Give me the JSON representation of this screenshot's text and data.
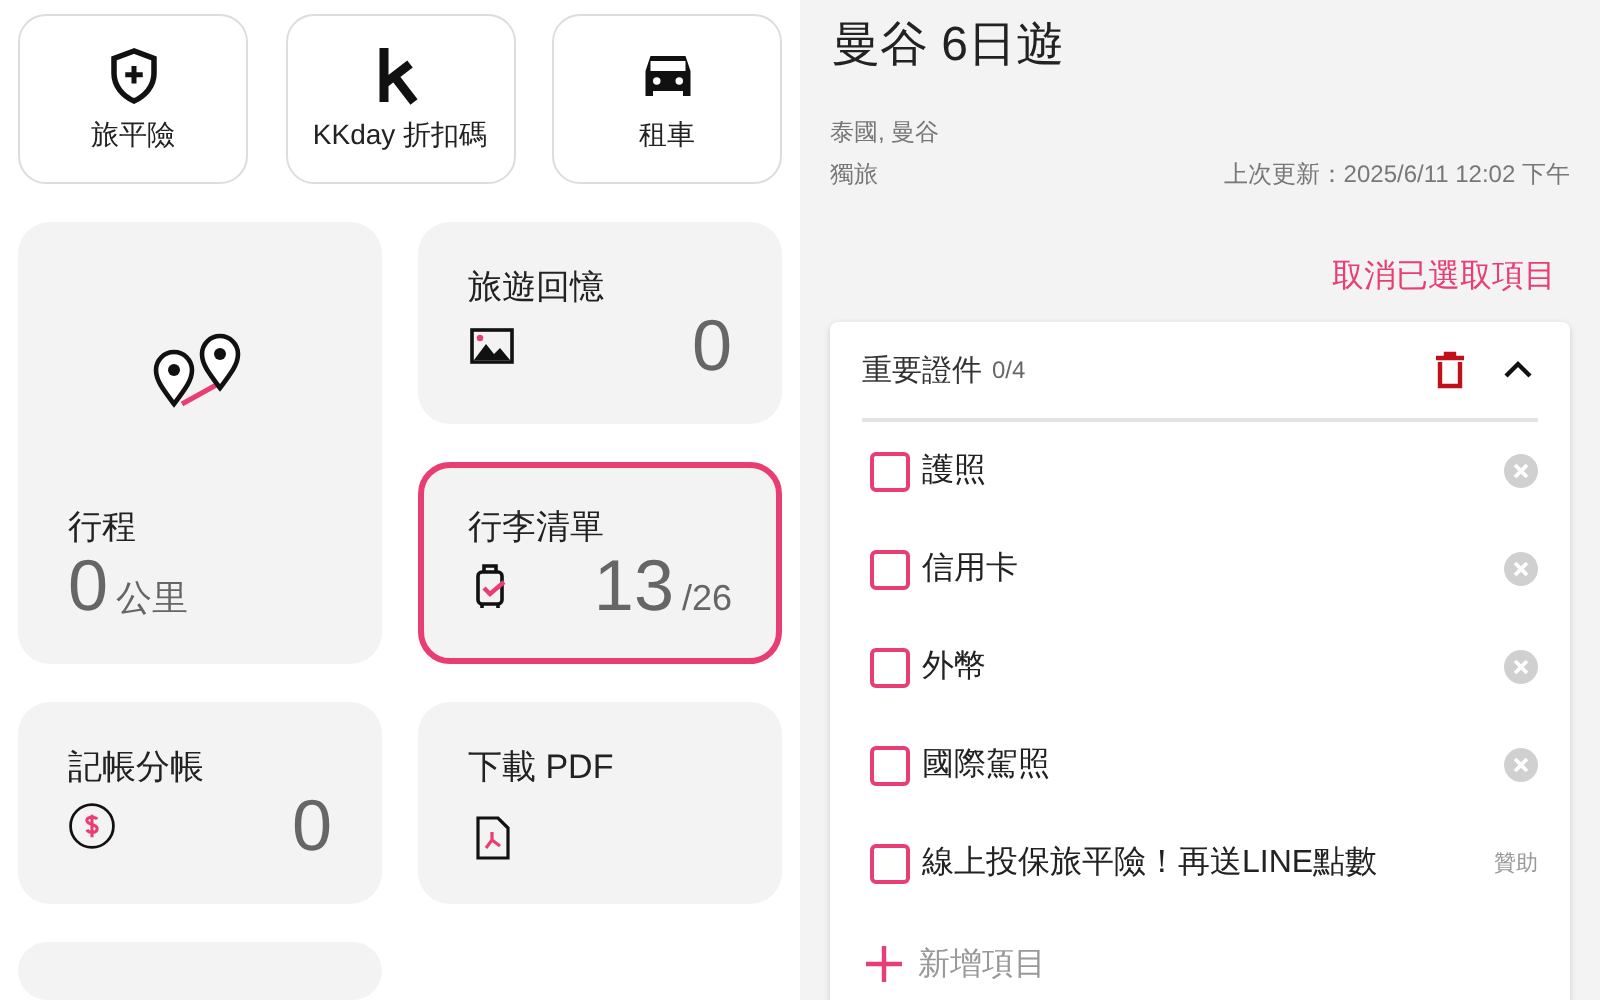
{
  "quick_actions": [
    {
      "kind": "shield",
      "label": "旅平險"
    },
    {
      "kind": "k",
      "label": "KKday 折扣碼"
    },
    {
      "kind": "car",
      "label": "租車"
    }
  ],
  "cards": [
    {
      "kind": "photos",
      "title": "旅遊回憶",
      "value": "0",
      "selected": false
    },
    {
      "kind": "route",
      "title": "行程",
      "value": "0",
      "unit": "公里",
      "selected": false
    },
    {
      "kind": "luggage",
      "title": "行李清單",
      "value": "13",
      "unit": "/26",
      "selected": true
    },
    {
      "kind": "money",
      "title": "記帳分帳",
      "value": "0",
      "selected": false
    },
    {
      "kind": "pdf",
      "title": "下載 PDF",
      "selected": false
    }
  ],
  "trip": {
    "title": "曼谷 6日遊",
    "location": "泰國, 曼谷",
    "type": "獨旅",
    "updated": "上次更新：2025/6/11 12:02 下午"
  },
  "clear_selection": "取消已選取項目",
  "checklist": {
    "title": "重要證件",
    "count": "0/4",
    "expanded": true,
    "items": [
      {
        "kind": "item",
        "label": "護照",
        "checked": false
      },
      {
        "kind": "item",
        "label": "信用卡",
        "checked": false
      },
      {
        "kind": "item",
        "label": "外幣",
        "checked": false
      },
      {
        "kind": "item",
        "label": "國際駕照",
        "checked": false
      },
      {
        "kind": "sponsored",
        "label": "線上投保旅平險！再送LINE點數",
        "tag": "贊助",
        "checked": false
      }
    ],
    "add_label": "新增項目"
  }
}
